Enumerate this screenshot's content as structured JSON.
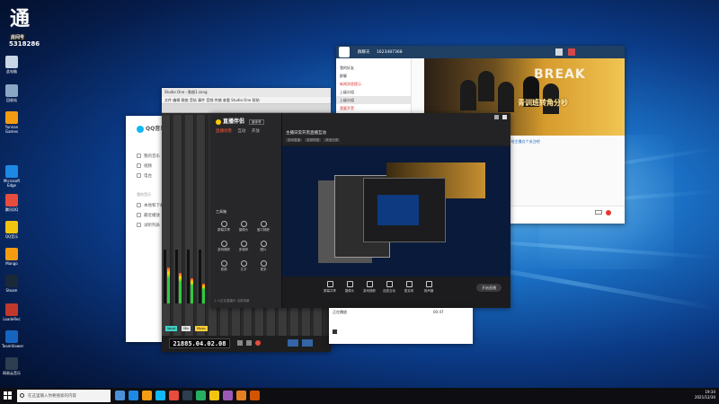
{
  "streamer_badge": {
    "title_char": "通",
    "room_tag": "房间号",
    "room_number": "5318286"
  },
  "desktop_icons": [
    {
      "label": "此电脑",
      "color": "#c8d6e5"
    },
    {
      "label": "回收站",
      "color": "#8aa7c5"
    },
    {
      "label": "Yunnan Games",
      "color": "#f39c12"
    },
    {
      "label": "Microsoft Edge",
      "color": "#1e88e5"
    },
    {
      "label": "腾讯QQ",
      "color": "#e74c3c"
    },
    {
      "label": "QQ音乐",
      "color": "#f1c40f"
    },
    {
      "label": "Mango",
      "color": "#f39c12"
    },
    {
      "label": "Steam",
      "color": "#1b2838"
    },
    {
      "label": "LoadeRec",
      "color": "#c0392b"
    },
    {
      "label": "TeamViewer",
      "color": "#1565c0"
    },
    {
      "label": "网易云音乐",
      "color": "#2c3e50"
    }
  ],
  "qq_window": {
    "brand": "QQ音乐",
    "menu": [
      "我的音乐",
      "视频",
      "电台"
    ],
    "section2": "我的音乐",
    "menu2": [
      "本地和下载",
      "最近播放",
      "试听列表"
    ]
  },
  "sound_window": {
    "title": "Studio One - 歌曲1.song",
    "menus": "文件 编辑 歌曲 音轨 事件 音频 传输 查看 Studio One 帮助",
    "counter": "21885.04.02.08",
    "chips": [
      {
        "label": "Vocal",
        "color": "#3fd3c6"
      },
      {
        "label": "Mic",
        "color": "#e0e0e0"
      },
      {
        "label": "Music",
        "color": "#ffcf3a"
      }
    ]
  },
  "group_window": {
    "title": "群聊天",
    "id_text": "1623487368",
    "side_items": [
      "我的好友",
      "群聊",
      "新闻消息提示",
      "上级分组",
      "上级分组",
      "我要开黑"
    ],
    "banner_text": "青训班转角分秒",
    "banner_title": "BREAK",
    "chat_line1": "大家好~ 欢迎来到我的直播间，给主播点个关注吧",
    "chat_line2": "喜欢的可以点个赞~"
  },
  "live_window": {
    "brand": "直播伴侣",
    "version": "版本号",
    "tabs": [
      "直播场景",
      "互动",
      "开放"
    ],
    "title": "主播日常开黑直播互动",
    "tags": [
      "游戏直播",
      "英雄联盟",
      "其他分类"
    ],
    "tools_label": "工具箱",
    "tools": [
      "屏幕共享",
      "摄像头",
      "窗口捕获",
      "游戏捕获",
      "多媒体",
      "图片",
      "音频",
      "文字",
      "更多"
    ],
    "bottom_note": "1 人正在直播中 当前场景",
    "controls": [
      "屏幕共享",
      "摄像头",
      "游戏捕获",
      "连麦互动",
      "麦克风",
      "扬声器"
    ],
    "start_label": "开始直播"
  },
  "music_window": {
    "track": "正在播放",
    "time": "00:47"
  },
  "taskbar": {
    "search_placeholder": "在这里输入你要搜索的内容",
    "time": "19:34",
    "date": "2021/12/30"
  }
}
